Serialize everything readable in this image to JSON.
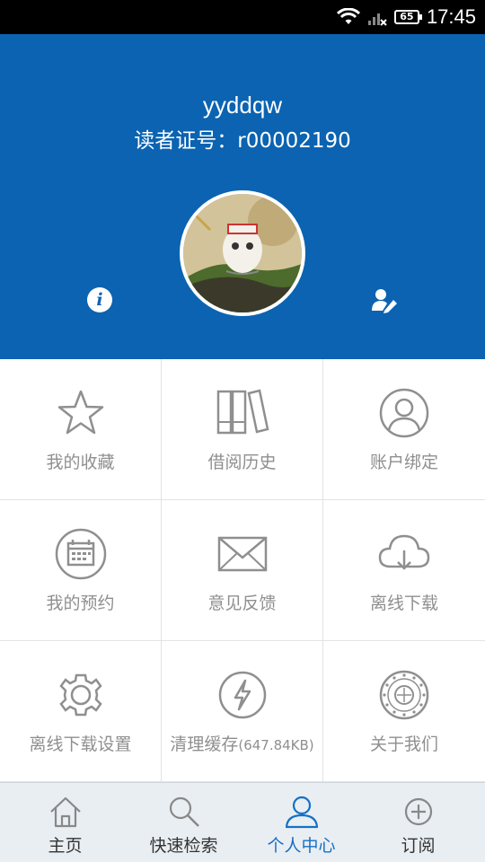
{
  "status_bar": {
    "time": "17:45",
    "battery": "65"
  },
  "profile": {
    "username": "yyddqw",
    "card_number_line": "读者证号：r00002190"
  },
  "grid": [
    {
      "label": "我的收藏",
      "icon": "star-icon"
    },
    {
      "label": "借阅历史",
      "icon": "books-icon"
    },
    {
      "label": "账户绑定",
      "icon": "user-circle-icon"
    },
    {
      "label": "我的预约",
      "icon": "calendar-icon"
    },
    {
      "label": "意见反馈",
      "icon": "envelope-icon"
    },
    {
      "label": "离线下载",
      "icon": "cloud-download-icon"
    },
    {
      "label": "离线下载设置",
      "icon": "gear-icon"
    },
    {
      "label": "清理缓存",
      "size": "(647.84KB)",
      "icon": "lightning-icon"
    },
    {
      "label": "关于我们",
      "icon": "library-seal-icon"
    }
  ],
  "tabs": [
    {
      "label": "主页",
      "icon": "home-icon"
    },
    {
      "label": "快速检索",
      "icon": "search-icon"
    },
    {
      "label": "个人中心",
      "icon": "person-icon",
      "active": true
    },
    {
      "label": "订阅",
      "icon": "plus-circle-icon"
    }
  ],
  "colors": {
    "header_bg": "#0b63b1",
    "active_tab": "#1570c8",
    "label_gray": "#8f8f8f"
  }
}
